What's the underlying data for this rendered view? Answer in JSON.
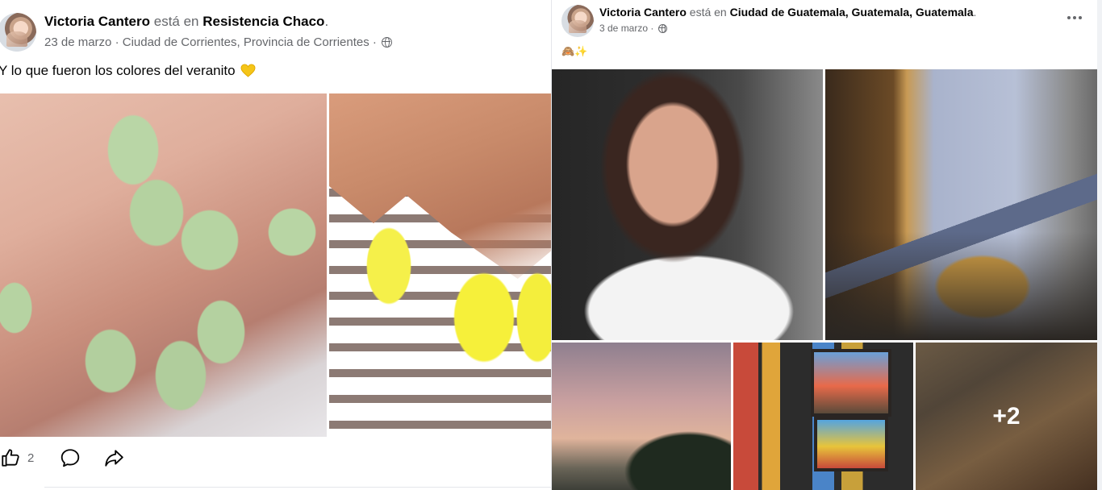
{
  "left_post": {
    "author": "Victoria Cantero",
    "verb": "está en",
    "place": "Resistencia Chaco",
    "place_end": ".",
    "date": "23 de marzo",
    "location": "Ciudad de Corrientes, Provincia de Corrientes",
    "separator": "·",
    "caption": "Y lo que fueron los colores del veranito",
    "caption_emoji": "yellow-heart",
    "reactions_count": "2"
  },
  "right_post": {
    "author": "Victoria Cantero",
    "verb": "está en",
    "place": "Ciudad de Guatemala, Guatemala, Guatemala",
    "place_end": ".",
    "date": "3 de marzo",
    "separator": "·",
    "caption_emoji": "🙈✨",
    "more_photos": "+2"
  },
  "colors": {
    "text_primary": "#050505",
    "text_secondary": "#65676b",
    "background": "#f0f2f5",
    "card": "#ffffff"
  }
}
